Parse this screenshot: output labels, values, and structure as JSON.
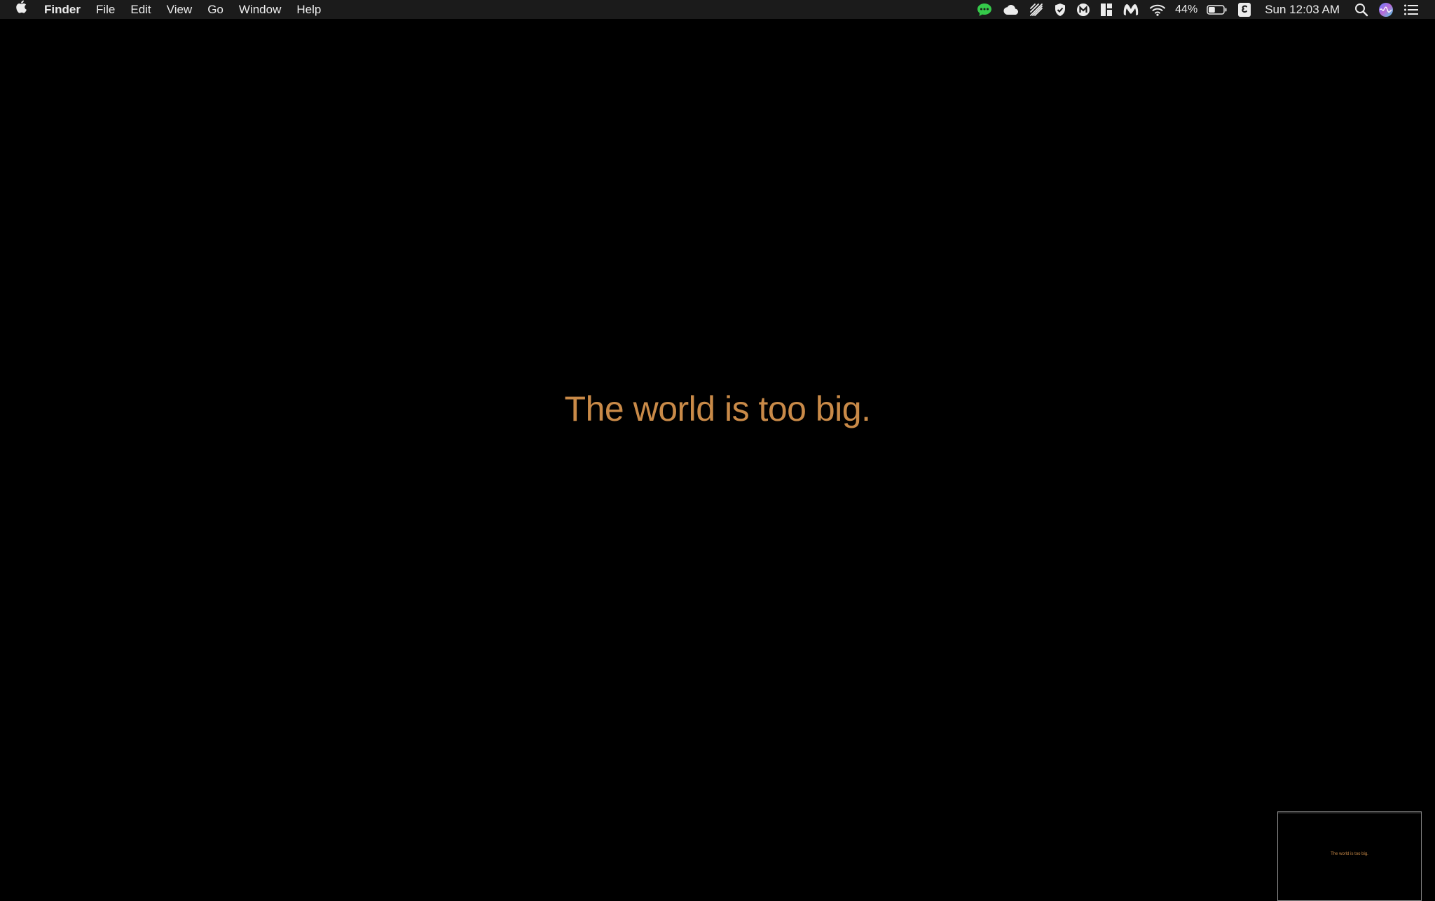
{
  "menubar": {
    "apple_icon": "apple-logo-icon",
    "app_name": "Finder",
    "menus": [
      "File",
      "Edit",
      "View",
      "Go",
      "Window",
      "Help"
    ],
    "status_icons": [
      "messages-icon",
      "cloud-icon",
      "scribble-icon",
      "shield-icon",
      "m-badge-icon",
      "layout-icon",
      "malwarebytes-icon",
      "wifi-icon"
    ],
    "battery_percent": "44%",
    "battery_level": 0.44,
    "clock": "Sun 12:03 AM",
    "trailing_icons": [
      "search-icon",
      "siri-icon",
      "notification-center-icon"
    ]
  },
  "desktop": {
    "wallpaper_text": "The world is too big.",
    "text_color": "#c98a48",
    "thumbnail_text": "The world is too big."
  },
  "colors": {
    "menubar_bg": "#1b1b1b",
    "desktop_bg": "#000000",
    "messages_green": "#35c94a"
  }
}
